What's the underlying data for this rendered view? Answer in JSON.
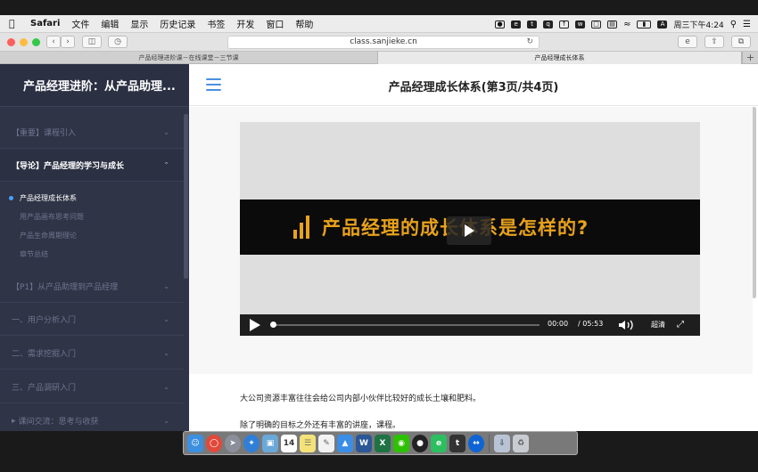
{
  "menubar": {
    "app_name": "Safari",
    "items": [
      "文件",
      "编辑",
      "显示",
      "历史记录",
      "书签",
      "开发",
      "窗口",
      "帮助"
    ],
    "clock": "周三下午4:24"
  },
  "toolbar": {
    "url": "class.sanjieke.cn",
    "colors": {
      "close": "#fc605c",
      "minimize": "#fdbc40",
      "zoom": "#34c84a"
    }
  },
  "tabs": [
    {
      "label": "产品经理进阶课－在线课堂－三节课",
      "active": false
    },
    {
      "label": "产品经理成长体系",
      "active": true
    }
  ],
  "sidebar": {
    "course_title": "产品经理进阶：从产品助理...",
    "sections": [
      {
        "label": "【重要】课程引入",
        "open": false
      },
      {
        "label": "【导论】产品经理的学习与成长",
        "open": true
      },
      {
        "label": "【P1】从产品助理到产品经理",
        "open": false
      },
      {
        "label": "一、用户分析入门",
        "open": false
      },
      {
        "label": "二、需求挖掘入门",
        "open": false
      },
      {
        "label": "三、产品调研入门",
        "open": false
      },
      {
        "label": "课间交流：思考与收获",
        "open": false
      }
    ],
    "lessons": [
      {
        "label": "产品经理成长体系",
        "active": true
      },
      {
        "label": "用产品画布思考问题",
        "active": false
      },
      {
        "label": "产品生命周期理论",
        "active": false
      },
      {
        "label": "章节总结",
        "active": false
      }
    ]
  },
  "main": {
    "page_title": "产品经理成长体系(第3页/共4页)",
    "video": {
      "banner_text": "产品经理的成长体系是怎样的?",
      "current_time": "00:00",
      "total_time": "/ 05:53",
      "quality": "超清",
      "progress": 0.0
    },
    "paragraphs": [
      "大公司资源丰富往往会给公司内部小伙伴比较好的成长土壤和肥料。",
      "除了明确的目标之外还有丰富的讲座，课程。"
    ]
  },
  "dock": {
    "apps": [
      "finder-icon",
      "chrome-icon",
      "launchpad-icon",
      "safari-icon",
      "preview-icon",
      "calendar-icon",
      "notes-icon",
      "textedit-icon",
      "keynote-icon",
      "word-icon",
      "excel-icon",
      "wechat-icon",
      "qq-icon",
      "evernote-icon",
      "typora-icon",
      "teamviewer-icon",
      "downloads-icon",
      "trash-icon"
    ],
    "calendar_day": "14"
  }
}
